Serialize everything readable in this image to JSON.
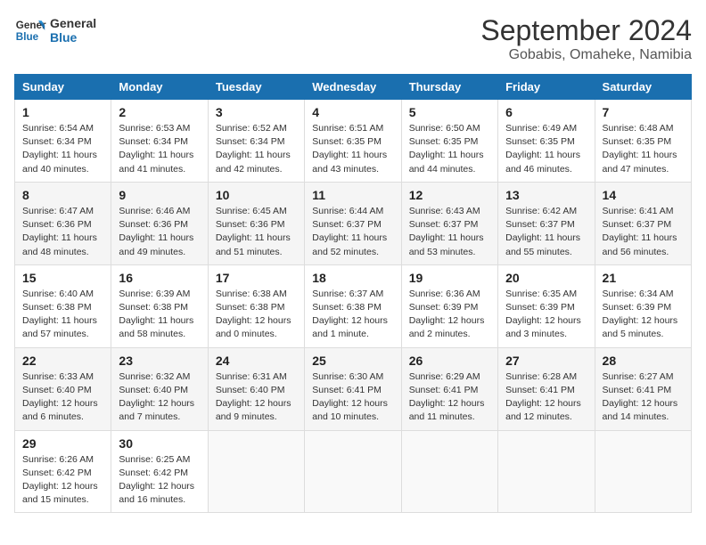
{
  "logo": {
    "line1": "General",
    "line2": "Blue"
  },
  "title": "September 2024",
  "subtitle": "Gobabis, Omaheke, Namibia",
  "weekdays": [
    "Sunday",
    "Monday",
    "Tuesday",
    "Wednesday",
    "Thursday",
    "Friday",
    "Saturday"
  ],
  "weeks": [
    [
      {
        "day": 1,
        "info": "Sunrise: 6:54 AM\nSunset: 6:34 PM\nDaylight: 11 hours\nand 40 minutes."
      },
      {
        "day": 2,
        "info": "Sunrise: 6:53 AM\nSunset: 6:34 PM\nDaylight: 11 hours\nand 41 minutes."
      },
      {
        "day": 3,
        "info": "Sunrise: 6:52 AM\nSunset: 6:34 PM\nDaylight: 11 hours\nand 42 minutes."
      },
      {
        "day": 4,
        "info": "Sunrise: 6:51 AM\nSunset: 6:35 PM\nDaylight: 11 hours\nand 43 minutes."
      },
      {
        "day": 5,
        "info": "Sunrise: 6:50 AM\nSunset: 6:35 PM\nDaylight: 11 hours\nand 44 minutes."
      },
      {
        "day": 6,
        "info": "Sunrise: 6:49 AM\nSunset: 6:35 PM\nDaylight: 11 hours\nand 46 minutes."
      },
      {
        "day": 7,
        "info": "Sunrise: 6:48 AM\nSunset: 6:35 PM\nDaylight: 11 hours\nand 47 minutes."
      }
    ],
    [
      {
        "day": 8,
        "info": "Sunrise: 6:47 AM\nSunset: 6:36 PM\nDaylight: 11 hours\nand 48 minutes."
      },
      {
        "day": 9,
        "info": "Sunrise: 6:46 AM\nSunset: 6:36 PM\nDaylight: 11 hours\nand 49 minutes."
      },
      {
        "day": 10,
        "info": "Sunrise: 6:45 AM\nSunset: 6:36 PM\nDaylight: 11 hours\nand 51 minutes."
      },
      {
        "day": 11,
        "info": "Sunrise: 6:44 AM\nSunset: 6:37 PM\nDaylight: 11 hours\nand 52 minutes."
      },
      {
        "day": 12,
        "info": "Sunrise: 6:43 AM\nSunset: 6:37 PM\nDaylight: 11 hours\nand 53 minutes."
      },
      {
        "day": 13,
        "info": "Sunrise: 6:42 AM\nSunset: 6:37 PM\nDaylight: 11 hours\nand 55 minutes."
      },
      {
        "day": 14,
        "info": "Sunrise: 6:41 AM\nSunset: 6:37 PM\nDaylight: 11 hours\nand 56 minutes."
      }
    ],
    [
      {
        "day": 15,
        "info": "Sunrise: 6:40 AM\nSunset: 6:38 PM\nDaylight: 11 hours\nand 57 minutes."
      },
      {
        "day": 16,
        "info": "Sunrise: 6:39 AM\nSunset: 6:38 PM\nDaylight: 11 hours\nand 58 minutes."
      },
      {
        "day": 17,
        "info": "Sunrise: 6:38 AM\nSunset: 6:38 PM\nDaylight: 12 hours\nand 0 minutes."
      },
      {
        "day": 18,
        "info": "Sunrise: 6:37 AM\nSunset: 6:38 PM\nDaylight: 12 hours\nand 1 minute."
      },
      {
        "day": 19,
        "info": "Sunrise: 6:36 AM\nSunset: 6:39 PM\nDaylight: 12 hours\nand 2 minutes."
      },
      {
        "day": 20,
        "info": "Sunrise: 6:35 AM\nSunset: 6:39 PM\nDaylight: 12 hours\nand 3 minutes."
      },
      {
        "day": 21,
        "info": "Sunrise: 6:34 AM\nSunset: 6:39 PM\nDaylight: 12 hours\nand 5 minutes."
      }
    ],
    [
      {
        "day": 22,
        "info": "Sunrise: 6:33 AM\nSunset: 6:40 PM\nDaylight: 12 hours\nand 6 minutes."
      },
      {
        "day": 23,
        "info": "Sunrise: 6:32 AM\nSunset: 6:40 PM\nDaylight: 12 hours\nand 7 minutes."
      },
      {
        "day": 24,
        "info": "Sunrise: 6:31 AM\nSunset: 6:40 PM\nDaylight: 12 hours\nand 9 minutes."
      },
      {
        "day": 25,
        "info": "Sunrise: 6:30 AM\nSunset: 6:41 PM\nDaylight: 12 hours\nand 10 minutes."
      },
      {
        "day": 26,
        "info": "Sunrise: 6:29 AM\nSunset: 6:41 PM\nDaylight: 12 hours\nand 11 minutes."
      },
      {
        "day": 27,
        "info": "Sunrise: 6:28 AM\nSunset: 6:41 PM\nDaylight: 12 hours\nand 12 minutes."
      },
      {
        "day": 28,
        "info": "Sunrise: 6:27 AM\nSunset: 6:41 PM\nDaylight: 12 hours\nand 14 minutes."
      }
    ],
    [
      {
        "day": 29,
        "info": "Sunrise: 6:26 AM\nSunset: 6:42 PM\nDaylight: 12 hours\nand 15 minutes."
      },
      {
        "day": 30,
        "info": "Sunrise: 6:25 AM\nSunset: 6:42 PM\nDaylight: 12 hours\nand 16 minutes."
      },
      null,
      null,
      null,
      null,
      null
    ]
  ]
}
